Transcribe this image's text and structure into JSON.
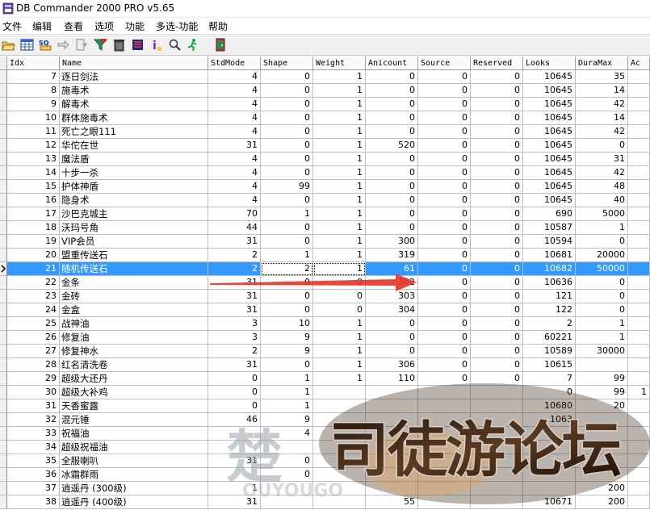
{
  "window": {
    "title": "DB Commander 2000 PRO v5.65"
  },
  "menu": [
    "文件",
    "编辑",
    "查看",
    "选项",
    "功能",
    "多选-功能",
    "帮助"
  ],
  "toolbar_icons": [
    "open-folder-icon",
    "table-grid-icon",
    "sql-query-icon",
    "arrow-right-icon",
    "export-icon",
    "filter-funnel-icon",
    "trash-icon",
    "database-icon",
    "column-letter-icon",
    "search-magnifier-icon",
    "running-man-icon",
    "exit-door-icon"
  ],
  "columns": [
    "Idx",
    "Name",
    "StdMode",
    "Shape",
    "Weight",
    "Anicount",
    "Source",
    "Reserved",
    "Looks",
    "DuraMax",
    "Ac"
  ],
  "rows": [
    [
      "7",
      "逐日剑法",
      "4",
      "0",
      "1",
      "0",
      "0",
      "0",
      "10645",
      "35",
      ""
    ],
    [
      "8",
      "施毒术",
      "4",
      "0",
      "1",
      "0",
      "0",
      "0",
      "10645",
      "14",
      ""
    ],
    [
      "9",
      "解毒术",
      "4",
      "0",
      "1",
      "0",
      "0",
      "0",
      "10645",
      "42",
      ""
    ],
    [
      "10",
      "群体施毒术",
      "4",
      "0",
      "1",
      "0",
      "0",
      "0",
      "10645",
      "14",
      ""
    ],
    [
      "11",
      "死亡之眼111",
      "4",
      "0",
      "1",
      "0",
      "0",
      "0",
      "10645",
      "42",
      ""
    ],
    [
      "12",
      "华佗在世",
      "31",
      "0",
      "1",
      "520",
      "0",
      "0",
      "10645",
      "0",
      ""
    ],
    [
      "13",
      "魔法盾",
      "4",
      "0",
      "1",
      "0",
      "0",
      "0",
      "10645",
      "31",
      ""
    ],
    [
      "14",
      "十步一杀",
      "4",
      "0",
      "1",
      "0",
      "0",
      "0",
      "10645",
      "42",
      ""
    ],
    [
      "15",
      "护体神盾",
      "4",
      "99",
      "1",
      "0",
      "0",
      "0",
      "10645",
      "48",
      ""
    ],
    [
      "16",
      "隐身术",
      "4",
      "0",
      "1",
      "0",
      "0",
      "0",
      "10645",
      "40",
      ""
    ],
    [
      "17",
      "沙巴克城主",
      "70",
      "1",
      "1",
      "0",
      "0",
      "0",
      "690",
      "5000",
      ""
    ],
    [
      "18",
      "沃玛号角",
      "44",
      "0",
      "1",
      "0",
      "0",
      "0",
      "10587",
      "1",
      ""
    ],
    [
      "19",
      "VIP会员",
      "31",
      "0",
      "1",
      "300",
      "0",
      "0",
      "10594",
      "0",
      ""
    ],
    [
      "20",
      "盟重传送石",
      "2",
      "1",
      "1",
      "319",
      "0",
      "0",
      "10681",
      "20000",
      ""
    ],
    [
      "21",
      "随机传送石",
      "2",
      "2",
      "1",
      "61",
      "0",
      "0",
      "10682",
      "50000",
      ""
    ],
    [
      "22",
      "金条",
      "31",
      "0",
      "0",
      "302",
      "0",
      "0",
      "10636",
      "0",
      ""
    ],
    [
      "23",
      "金砖",
      "31",
      "0",
      "0",
      "303",
      "0",
      "0",
      "121",
      "0",
      ""
    ],
    [
      "24",
      "金盒",
      "31",
      "0",
      "0",
      "304",
      "0",
      "0",
      "122",
      "0",
      ""
    ],
    [
      "25",
      "战神油",
      "3",
      "10",
      "1",
      "0",
      "0",
      "0",
      "2",
      "1",
      ""
    ],
    [
      "26",
      "修复油",
      "3",
      "9",
      "1",
      "0",
      "0",
      "0",
      "60221",
      "1",
      ""
    ],
    [
      "27",
      "修复神水",
      "2",
      "9",
      "1",
      "0",
      "0",
      "0",
      "10589",
      "30000",
      ""
    ],
    [
      "28",
      "红名清洗卷",
      "31",
      "0",
      "1",
      "306",
      "0",
      "0",
      "10615",
      "",
      ""
    ],
    [
      "29",
      "超级大还丹",
      "0",
      "1",
      "1",
      "110",
      "0",
      "0",
      "7",
      "99",
      ""
    ],
    [
      "30",
      "超级大补鸡",
      "0",
      "1",
      "",
      "",
      "",
      "",
      "0",
      "99",
      "1"
    ],
    [
      "31",
      "天香蜜露",
      "0",
      "1",
      "",
      "",
      "",
      "",
      "10680",
      "20",
      ""
    ],
    [
      "32",
      "混元锤",
      "46",
      "9",
      "",
      "",
      "",
      "",
      "1063",
      "",
      ""
    ],
    [
      "33",
      "祝福油",
      "",
      "4",
      "",
      "",
      "",
      "",
      "",
      "",
      ""
    ],
    [
      "34",
      "超级祝福油",
      "",
      "",
      "",
      "",
      "",
      "",
      "",
      "",
      ""
    ],
    [
      "35",
      "全服喇叭",
      "31",
      "0",
      "",
      "",
      "",
      "",
      "",
      "",
      ""
    ],
    [
      "36",
      "冰霜群雨",
      "",
      "0",
      "",
      "",
      "",
      "",
      "",
      "",
      ""
    ],
    [
      "37",
      "逍遥丹 (300级)",
      "1",
      "",
      "",
      "",
      "",
      "",
      "",
      "200",
      ""
    ],
    [
      "38",
      "逍遥丹 (400级)",
      "31",
      "",
      "",
      "55",
      "",
      "",
      "10671",
      "200",
      ""
    ]
  ],
  "selected_row": 14,
  "colors": {
    "selection": "#3399ff",
    "arrow": "#e8372a",
    "header_bg": "#f0f0f0"
  },
  "watermark": {
    "text": "司徒游论坛",
    "ghost_text": "楚",
    "ghost_latin": "OUYOUGO"
  }
}
